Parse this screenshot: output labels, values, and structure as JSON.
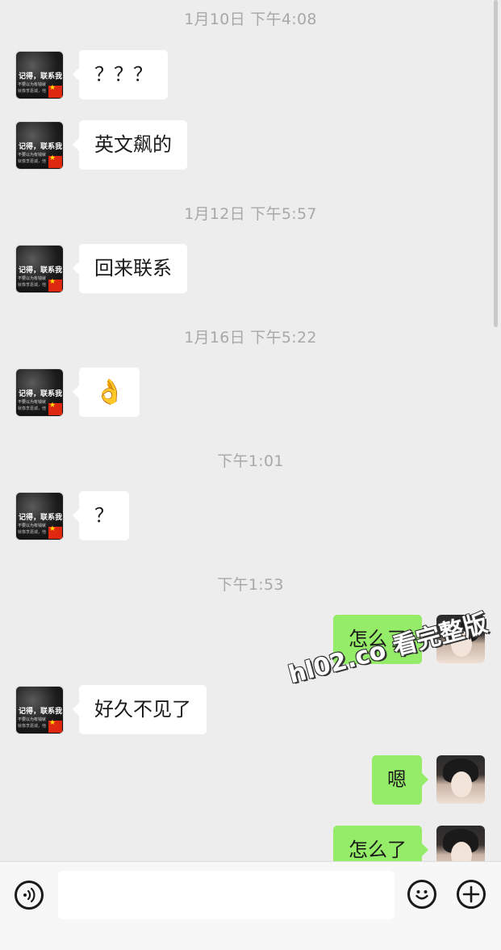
{
  "contact_avatar": {
    "line1": "记得，联系我!",
    "line2": "不要以为有钱就",
    "line3": "就像李嘉诚，他"
  },
  "messages": [
    {
      "type": "time",
      "text": "1月10日 下午4:08"
    },
    {
      "type": "in",
      "text": "？？？"
    },
    {
      "type": "in",
      "text": "英文飙的"
    },
    {
      "type": "time",
      "text": "1月12日 下午5:57"
    },
    {
      "type": "in",
      "text": "回来联系"
    },
    {
      "type": "time",
      "text": "1月16日 下午5:22"
    },
    {
      "type": "in",
      "text": "👌"
    },
    {
      "type": "time",
      "text": "下午1:01"
    },
    {
      "type": "in",
      "text": "？"
    },
    {
      "type": "time",
      "text": "下午1:53"
    },
    {
      "type": "out",
      "text": "怎么了"
    },
    {
      "type": "in",
      "text": "好久不见了"
    },
    {
      "type": "out",
      "text": "嗯"
    },
    {
      "type": "out",
      "text": "怎么了"
    }
  ],
  "watermark": "hl02.co 看完整版",
  "input_bar": {
    "voice_icon": "voice-icon",
    "emoji_icon": "emoji-icon",
    "plus_icon": "plus-icon",
    "input_value": ""
  },
  "colors": {
    "background": "#ededed",
    "incoming_bubble": "#ffffff",
    "outgoing_bubble": "#95ec69",
    "timestamp": "#a8a8a8"
  }
}
